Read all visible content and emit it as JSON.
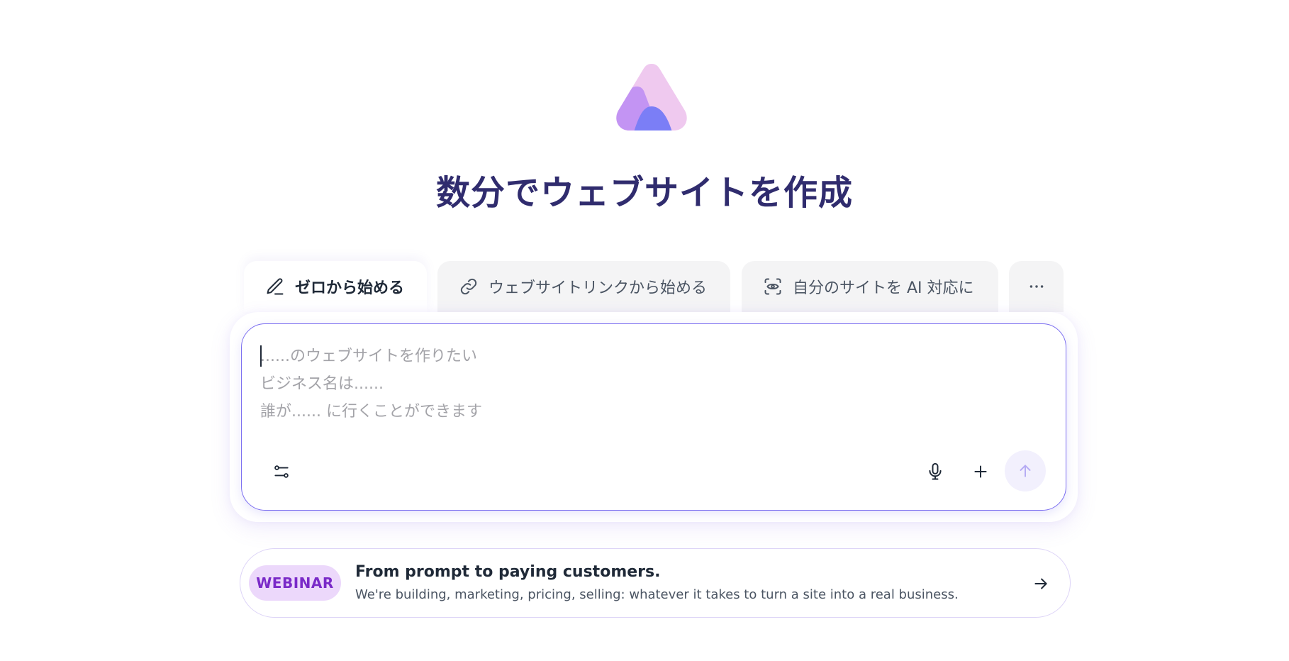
{
  "header": {
    "headline": "数分でウェブサイトを作成"
  },
  "tabs": [
    {
      "label": "ゼロから始める",
      "icon": "pencil-icon",
      "active": true
    },
    {
      "label": "ウェブサイトリンクから始める",
      "icon": "link-icon",
      "active": false
    },
    {
      "label": "自分のサイトを AI 対応に",
      "icon": "scan-eye-icon",
      "active": false
    },
    {
      "label": "",
      "icon": "more-horizontal-icon",
      "active": false
    }
  ],
  "prompt": {
    "placeholder_lines": [
      "......のウェブサイトを作りたい",
      "ビジネス名は......",
      "誰が...... に行くことができます"
    ],
    "icons": {
      "settings": "sliders-icon",
      "mic": "microphone-icon",
      "add": "plus-icon",
      "send": "arrow-up-icon"
    }
  },
  "banner": {
    "badge": "WEBINAR",
    "title": "From prompt to paying customers.",
    "subtitle": "We're building, marketing, pricing, selling: whatever it takes to turn a site into a real business.",
    "icon": "arrow-right-icon"
  },
  "colors": {
    "headline": "#302c6e",
    "accent": "#7c6ff0",
    "badge_bg": "#ecd8fb",
    "badge_text": "#7a2ac8"
  }
}
